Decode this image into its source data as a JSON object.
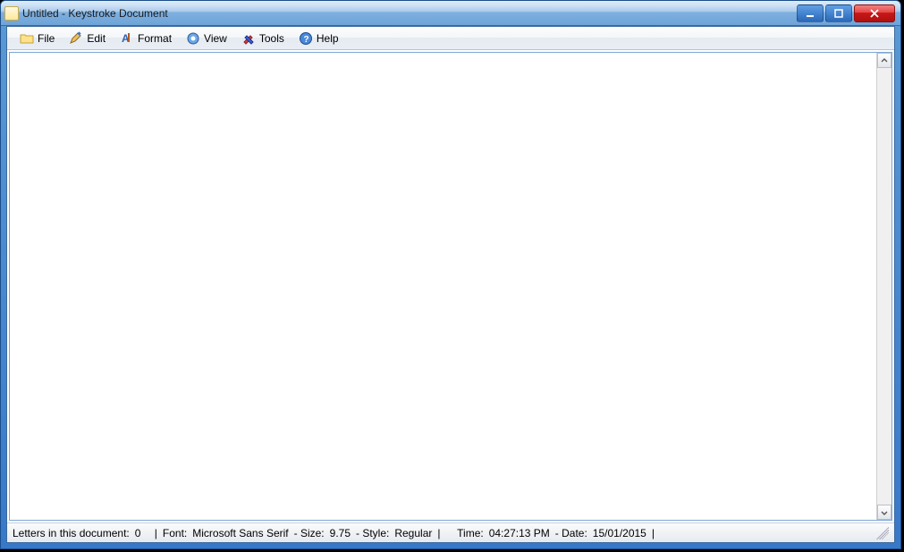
{
  "window": {
    "title": "Untitled - Keystroke Document"
  },
  "menu": {
    "file": "File",
    "edit": "Edit",
    "format": "Format",
    "view": "View",
    "tools": "Tools",
    "help": "Help"
  },
  "editor": {
    "content": ""
  },
  "status": {
    "letters_label": "Letters in this document:",
    "letters_count": "0",
    "sep": "|",
    "font_label": "Font:",
    "font_name": "Microsoft Sans Serif",
    "size_label": "- Size:",
    "font_size": "9.75",
    "style_label": "- Style:",
    "font_style": "Regular",
    "time_label": "Time:",
    "time_value": "04:27:13 PM",
    "date_label": "- Date:",
    "date_value": "15/01/2015"
  }
}
